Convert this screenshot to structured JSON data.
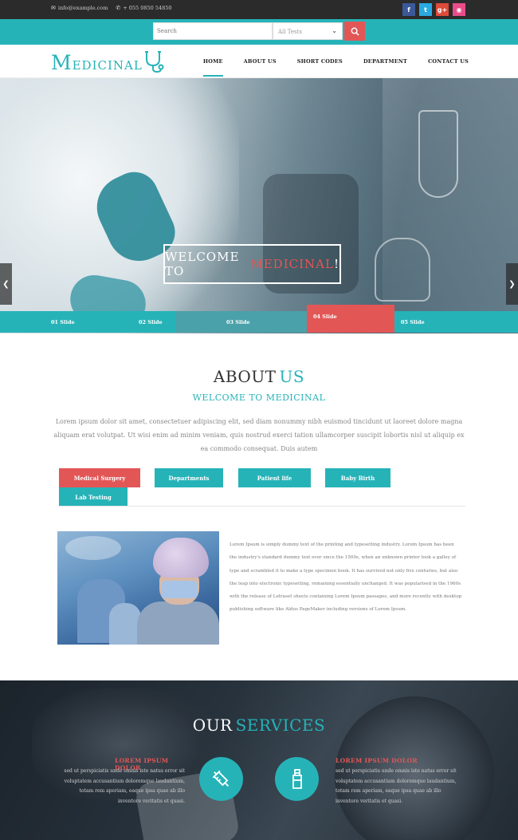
{
  "topbar": {
    "email": "info@example.com",
    "phone": "+ 055 0850 54850",
    "social": [
      {
        "icon": "facebook-icon",
        "glyph": "f",
        "color": "#3b5998"
      },
      {
        "icon": "twitter-icon",
        "glyph": "t",
        "color": "#2aa9e0"
      },
      {
        "icon": "google-plus-icon",
        "glyph": "g+",
        "color": "#dd4b39"
      },
      {
        "icon": "dribbble-icon",
        "glyph": "◉",
        "color": "#ea4c89"
      }
    ]
  },
  "search": {
    "placeholder": "Search",
    "select_value": "All Tests"
  },
  "header": {
    "logo_first": "M",
    "logo_rest": "EDICINAL",
    "nav": [
      "HOME",
      "ABOUT US",
      "SHORT CODES",
      "DEPARTMENT",
      "CONTACT US"
    ]
  },
  "hero": {
    "welcome_prefix": "WELCOME TO",
    "welcome_accent": "MEDICINAL",
    "welcome_suffix": "!",
    "dots": 5,
    "active_dot": 4,
    "slides": [
      "01 Slide",
      "02 Slide",
      "03 Slide",
      "04 Slide",
      "05 Slide"
    ],
    "active_slide": 4
  },
  "about": {
    "title": "ABOUT",
    "title_accent": "US",
    "subtitle": "WELCOME TO MEDICINAL",
    "text": "Lorem ipsum dolor sit amet, consectetuer adipiscing elit, sed diam nonummy nibh euismod tincidunt ut laoreet dolore magna aliquam erat volutpat. Ut wisi enim ad minim veniam, quis nostrud exerci tation ullamcorper suscipit lobortis nisl ut aliquip ex ea commodo consequat. Duis autem",
    "tabs": [
      "Medical Surgery",
      "Departments",
      "Patient life",
      "Baby Birth",
      "Lab Testing"
    ],
    "active_tab": 0,
    "tab_text": "Lorem Ipsum is simply dummy text of the printing and typesetting industry. Lorem Ipsum has been the industry's standard dummy text ever since the 1500s, when an unknown printer took a galley of type and scrambled it to make a type specimen book. It has survived not only five centuries, but also the leap into electronic typesetting, remaining essentially unchanged. It was popularised in the 1960s with the release of Letraset sheets containing Lorem Ipsum passages, and more recently with desktop publishing software like Aldus PageMaker including versions of Lorem Ipsum."
  },
  "services": {
    "title": "OUR",
    "title_accent": "SERVICES",
    "left": {
      "heading": "LOREM IPSUM DOLOR",
      "text": "sed ut perspiciatis unde omnis iste natus error sit voluptatem accusantium doloremque laudantium, totam rem aperiam, eaque ipsa quae ab illo inventore veritatis et quasi."
    },
    "right": {
      "heading": "LOREM IPSUM DOLOR",
      "text": "sed ut perspiciatis unde omnis iste natus error sit voluptatem accusantium doloremque laudantium, totam rem aperiam, eaque ipsa quae ab illo inventore veritatis et quasi."
    },
    "icons": [
      "syringe-icon",
      "vial-icon"
    ]
  },
  "colors": {
    "teal": "#26b3b8",
    "red": "#e35656",
    "dark": "#2b2b2b"
  }
}
